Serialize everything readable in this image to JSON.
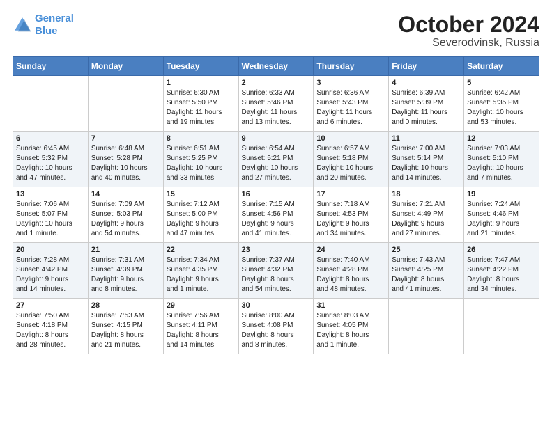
{
  "header": {
    "logo_line1": "General",
    "logo_line2": "Blue",
    "title": "October 2024",
    "subtitle": "Severodvinsk, Russia"
  },
  "columns": [
    "Sunday",
    "Monday",
    "Tuesday",
    "Wednesday",
    "Thursday",
    "Friday",
    "Saturday"
  ],
  "weeks": [
    [
      {
        "day": "",
        "info": ""
      },
      {
        "day": "",
        "info": ""
      },
      {
        "day": "1",
        "info": "Sunrise: 6:30 AM\nSunset: 5:50 PM\nDaylight: 11 hours\nand 19 minutes."
      },
      {
        "day": "2",
        "info": "Sunrise: 6:33 AM\nSunset: 5:46 PM\nDaylight: 11 hours\nand 13 minutes."
      },
      {
        "day": "3",
        "info": "Sunrise: 6:36 AM\nSunset: 5:43 PM\nDaylight: 11 hours\nand 6 minutes."
      },
      {
        "day": "4",
        "info": "Sunrise: 6:39 AM\nSunset: 5:39 PM\nDaylight: 11 hours\nand 0 minutes."
      },
      {
        "day": "5",
        "info": "Sunrise: 6:42 AM\nSunset: 5:35 PM\nDaylight: 10 hours\nand 53 minutes."
      }
    ],
    [
      {
        "day": "6",
        "info": "Sunrise: 6:45 AM\nSunset: 5:32 PM\nDaylight: 10 hours\nand 47 minutes."
      },
      {
        "day": "7",
        "info": "Sunrise: 6:48 AM\nSunset: 5:28 PM\nDaylight: 10 hours\nand 40 minutes."
      },
      {
        "day": "8",
        "info": "Sunrise: 6:51 AM\nSunset: 5:25 PM\nDaylight: 10 hours\nand 33 minutes."
      },
      {
        "day": "9",
        "info": "Sunrise: 6:54 AM\nSunset: 5:21 PM\nDaylight: 10 hours\nand 27 minutes."
      },
      {
        "day": "10",
        "info": "Sunrise: 6:57 AM\nSunset: 5:18 PM\nDaylight: 10 hours\nand 20 minutes."
      },
      {
        "day": "11",
        "info": "Sunrise: 7:00 AM\nSunset: 5:14 PM\nDaylight: 10 hours\nand 14 minutes."
      },
      {
        "day": "12",
        "info": "Sunrise: 7:03 AM\nSunset: 5:10 PM\nDaylight: 10 hours\nand 7 minutes."
      }
    ],
    [
      {
        "day": "13",
        "info": "Sunrise: 7:06 AM\nSunset: 5:07 PM\nDaylight: 10 hours\nand 1 minute."
      },
      {
        "day": "14",
        "info": "Sunrise: 7:09 AM\nSunset: 5:03 PM\nDaylight: 9 hours\nand 54 minutes."
      },
      {
        "day": "15",
        "info": "Sunrise: 7:12 AM\nSunset: 5:00 PM\nDaylight: 9 hours\nand 47 minutes."
      },
      {
        "day": "16",
        "info": "Sunrise: 7:15 AM\nSunset: 4:56 PM\nDaylight: 9 hours\nand 41 minutes."
      },
      {
        "day": "17",
        "info": "Sunrise: 7:18 AM\nSunset: 4:53 PM\nDaylight: 9 hours\nand 34 minutes."
      },
      {
        "day": "18",
        "info": "Sunrise: 7:21 AM\nSunset: 4:49 PM\nDaylight: 9 hours\nand 27 minutes."
      },
      {
        "day": "19",
        "info": "Sunrise: 7:24 AM\nSunset: 4:46 PM\nDaylight: 9 hours\nand 21 minutes."
      }
    ],
    [
      {
        "day": "20",
        "info": "Sunrise: 7:28 AM\nSunset: 4:42 PM\nDaylight: 9 hours\nand 14 minutes."
      },
      {
        "day": "21",
        "info": "Sunrise: 7:31 AM\nSunset: 4:39 PM\nDaylight: 9 hours\nand 8 minutes."
      },
      {
        "day": "22",
        "info": "Sunrise: 7:34 AM\nSunset: 4:35 PM\nDaylight: 9 hours\nand 1 minute."
      },
      {
        "day": "23",
        "info": "Sunrise: 7:37 AM\nSunset: 4:32 PM\nDaylight: 8 hours\nand 54 minutes."
      },
      {
        "day": "24",
        "info": "Sunrise: 7:40 AM\nSunset: 4:28 PM\nDaylight: 8 hours\nand 48 minutes."
      },
      {
        "day": "25",
        "info": "Sunrise: 7:43 AM\nSunset: 4:25 PM\nDaylight: 8 hours\nand 41 minutes."
      },
      {
        "day": "26",
        "info": "Sunrise: 7:47 AM\nSunset: 4:22 PM\nDaylight: 8 hours\nand 34 minutes."
      }
    ],
    [
      {
        "day": "27",
        "info": "Sunrise: 7:50 AM\nSunset: 4:18 PM\nDaylight: 8 hours\nand 28 minutes."
      },
      {
        "day": "28",
        "info": "Sunrise: 7:53 AM\nSunset: 4:15 PM\nDaylight: 8 hours\nand 21 minutes."
      },
      {
        "day": "29",
        "info": "Sunrise: 7:56 AM\nSunset: 4:11 PM\nDaylight: 8 hours\nand 14 minutes."
      },
      {
        "day": "30",
        "info": "Sunrise: 8:00 AM\nSunset: 4:08 PM\nDaylight: 8 hours\nand 8 minutes."
      },
      {
        "day": "31",
        "info": "Sunrise: 8:03 AM\nSunset: 4:05 PM\nDaylight: 8 hours\nand 1 minute."
      },
      {
        "day": "",
        "info": ""
      },
      {
        "day": "",
        "info": ""
      }
    ]
  ]
}
